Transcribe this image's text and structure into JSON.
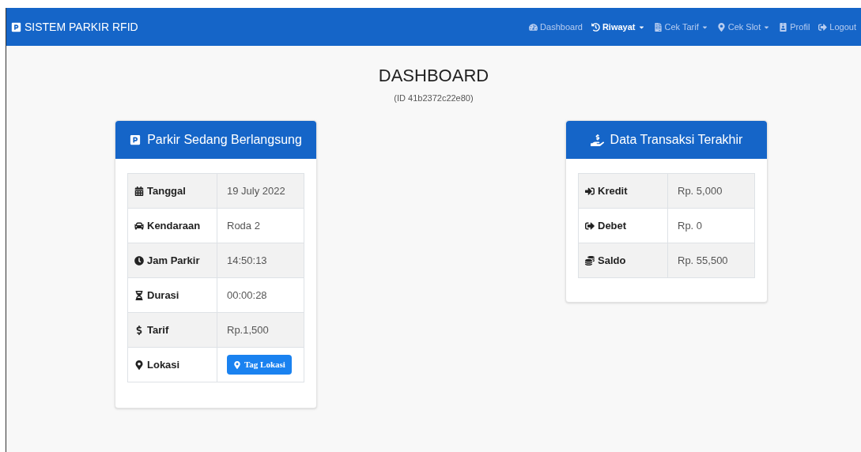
{
  "navbar": {
    "brand": "SISTEM PARKIR RFID",
    "items": [
      {
        "kind": "dashboard",
        "label": "Dashboard",
        "selected": false,
        "dropdown": false
      },
      {
        "kind": "history",
        "label": "Riwayat",
        "selected": true,
        "dropdown": true
      },
      {
        "kind": "document",
        "label": "Cek Tarif",
        "selected": false,
        "dropdown": true
      },
      {
        "kind": "pin",
        "label": "Cek Slot",
        "selected": false,
        "dropdown": true
      },
      {
        "kind": "badge",
        "label": "Profil",
        "selected": false,
        "dropdown": false
      },
      {
        "kind": "logout",
        "label": "Logout",
        "selected": false,
        "dropdown": false
      }
    ]
  },
  "page": {
    "title": "DASHBOARD",
    "subtitle": "(ID 41b2372c22e80)"
  },
  "parking_card": {
    "title": "Parkir Sedang Berlangsung",
    "rows": [
      {
        "kind": "calendar",
        "label": "Tanggal",
        "value": "19 July 2022"
      },
      {
        "kind": "car",
        "label": "Kendaraan",
        "value": "Roda 2"
      },
      {
        "kind": "clock",
        "label": "Jam Parkir",
        "value": "14:50:13"
      },
      {
        "kind": "hourglass",
        "label": "Durasi",
        "value": "00:00:28"
      },
      {
        "kind": "dollar",
        "label": "Tarif",
        "value": "Rp.1,500"
      },
      {
        "kind": "pin",
        "label": "Lokasi",
        "button": "Tag Lokasi"
      }
    ]
  },
  "transaction_card": {
    "title": "Data Transaksi Terakhir",
    "rows": [
      {
        "kind": "login",
        "label": "Kredit",
        "value": "Rp. 5,000"
      },
      {
        "kind": "logout",
        "label": "Debet",
        "value": "Rp. 0"
      },
      {
        "kind": "coins",
        "label": "Saldo",
        "value": "Rp. 55,500"
      }
    ]
  }
}
